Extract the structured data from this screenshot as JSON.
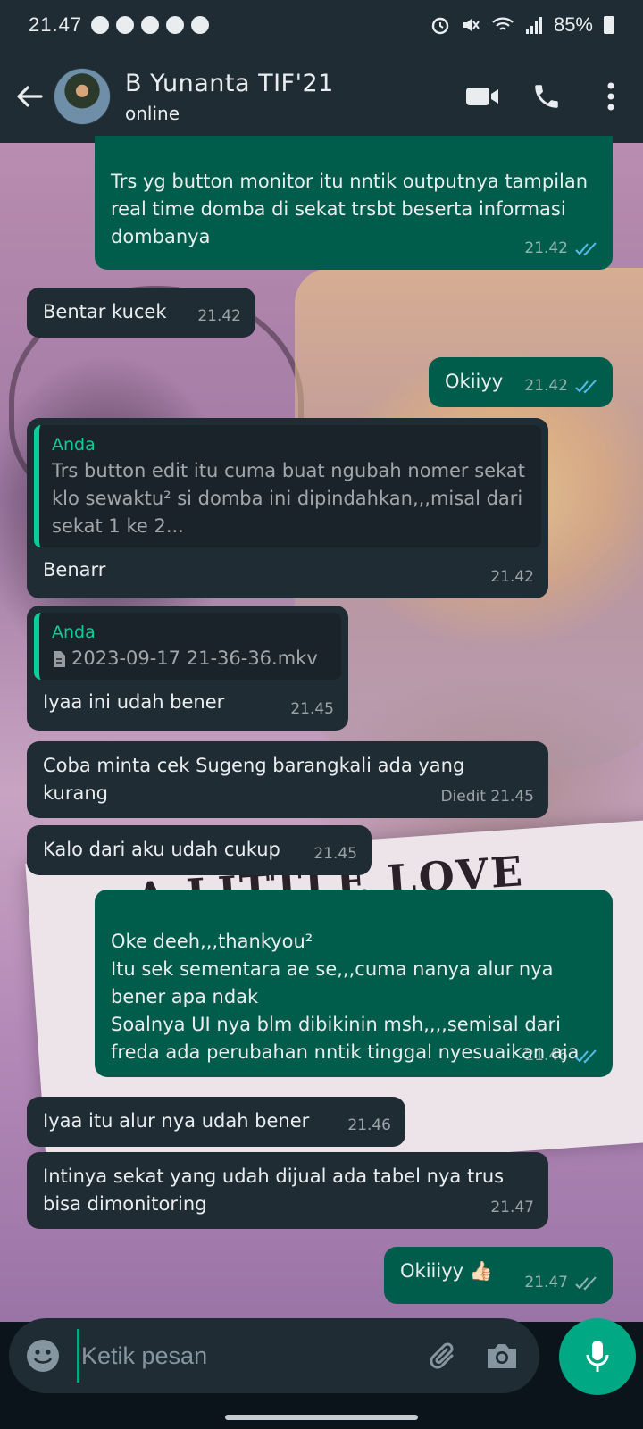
{
  "status_bar": {
    "time": "21.47",
    "battery": "85%"
  },
  "header": {
    "contact_name": "B Yunanta TIF'21",
    "status": "online"
  },
  "messages": [
    {
      "dir": "out",
      "text": "Trs yg button monitor itu nntik outputnya tampilan real time domba di sekat trsbt beserta informasi dombanya",
      "time": "21.42"
    },
    {
      "dir": "in",
      "text": "Bentar kucek",
      "time": "21.42"
    },
    {
      "dir": "out",
      "text": "Okiiyy",
      "time": "21.42"
    },
    {
      "dir": "in",
      "quote_author": "Anda",
      "quote_text": "Trs button edit itu cuma buat ngubah nomer sekat klo sewaktu² si domba ini dipindahkan,,,misal dari sekat 1 ke 2...",
      "text": "Benarr",
      "time": "21.42"
    },
    {
      "dir": "in",
      "quote_author": "Anda",
      "quote_file": "2023-09-17 21-36-36.mkv",
      "text": "Iyaa ini udah bener",
      "time": "21.45"
    },
    {
      "dir": "in",
      "text": "Coba minta cek Sugeng barangkali ada yang kurang",
      "time": "Diedit 21.45"
    },
    {
      "dir": "in",
      "text": "Kalo dari aku udah cukup",
      "time": "21.45"
    },
    {
      "dir": "out",
      "text": "Oke deeh,,,thankyou²\nItu sek sementara ae se,,,cuma nanya alur nya bener apa ndak\nSoalnya UI nya blm dibikinin msh,,,,semisal dari freda ada perubahan nntik tinggal nyesuaikan aja",
      "time": "21.46"
    },
    {
      "dir": "in",
      "text": "Iyaa itu alur nya udah bener",
      "time": "21.46"
    },
    {
      "dir": "in",
      "text": "Intinya sekat yang udah dijual ada tabel nya trus bisa dimonitoring",
      "time": "21.47"
    },
    {
      "dir": "out",
      "text": "Okiiiyy 👍🏻",
      "time": "21.47"
    }
  ],
  "wallpaper": {
    "text": "A LITTLE LOVE STORY"
  },
  "composer": {
    "placeholder": "Ketik pesan"
  },
  "colors": {
    "incoming": "#202c33",
    "outgoing": "#005c4b",
    "accent": "#00a884",
    "read_tick": "#53bdeb"
  }
}
